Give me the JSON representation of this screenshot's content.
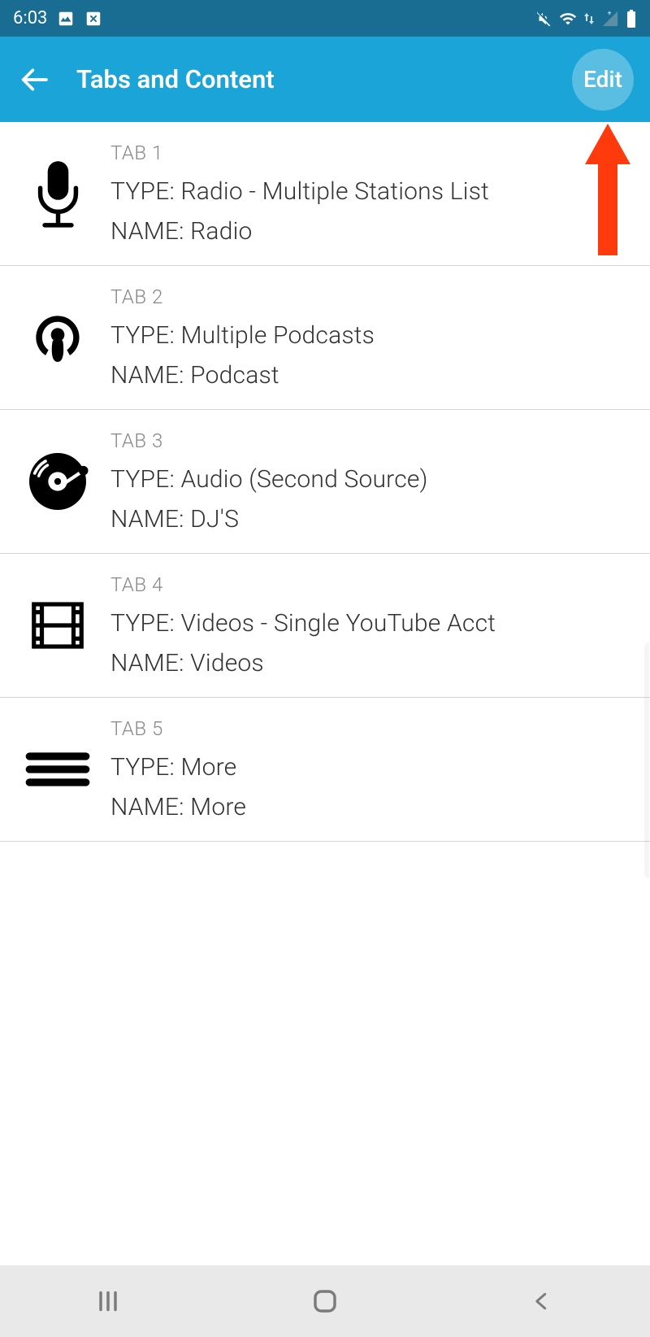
{
  "status": {
    "time": "6:03"
  },
  "appbar": {
    "title": "Tabs and Content",
    "edit_label": "Edit"
  },
  "labels": {
    "type_prefix": "TYPE: ",
    "name_prefix": "NAME: "
  },
  "tabs": [
    {
      "header": "TAB 1",
      "type": "Radio - Multiple Stations List",
      "name": "Radio",
      "icon": "microphone"
    },
    {
      "header": "TAB 2",
      "type": "Multiple Podcasts",
      "name": "Podcast",
      "icon": "podcast"
    },
    {
      "header": "TAB 3",
      "type": "Audio (Second Source)",
      "name": "DJ'S",
      "icon": "vinyl"
    },
    {
      "header": "TAB 4",
      "type": "Videos - Single YouTube Acct",
      "name": "Videos",
      "icon": "film"
    },
    {
      "header": "TAB 5",
      "type": "More",
      "name": "More",
      "icon": "more"
    }
  ]
}
